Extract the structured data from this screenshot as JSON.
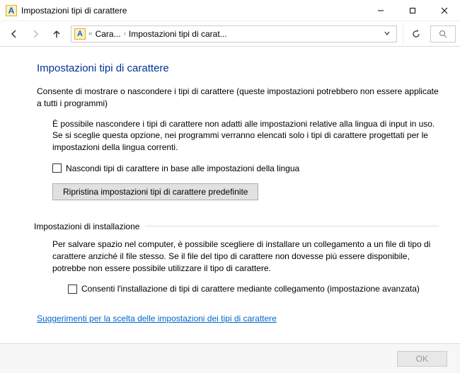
{
  "window": {
    "title": "Impostazioni tipi di carattere",
    "icon_letter": "A"
  },
  "breadcrumb": {
    "icon_letter": "A",
    "seg1": "Cara...",
    "seg2": "Impostazioni tipi di carat..."
  },
  "page": {
    "title": "Impostazioni tipi di carattere",
    "intro": "Consente di mostrare o nascondere i tipi di carattere (queste impostazioni potrebbero non essere applicate a tutti i programmi)",
    "hide_desc": "È possibile nascondere i tipi di carattere non adatti alle impostazioni relative alla lingua di input in uso. Se si sceglie questa opzione, nei programmi verranno elencati solo i tipi di carattere progettati per le impostazioni della lingua correnti.",
    "hide_checkbox_label": "Nascondi tipi di carattere in base alle impostazioni della lingua",
    "restore_button": "Ripristina impostazioni tipi di carattere predefinite",
    "install_header": "Impostazioni di installazione",
    "install_desc": "Per salvare spazio nel computer, è possibile scegliere di installare un collegamento a un file di tipo di carattere anziché il file stesso. Se il file del tipo di carattere non dovesse più essere disponibile, potrebbe non essere possibile utilizzare il tipo di carattere.",
    "shortcut_checkbox_label": "Consenti l'installazione di tipi di carattere mediante collegamento (impostazione avanzata)",
    "help_link": "Suggerimenti per la scelta delle impostazioni dei tipi di carattere",
    "ok_button": "OK"
  }
}
